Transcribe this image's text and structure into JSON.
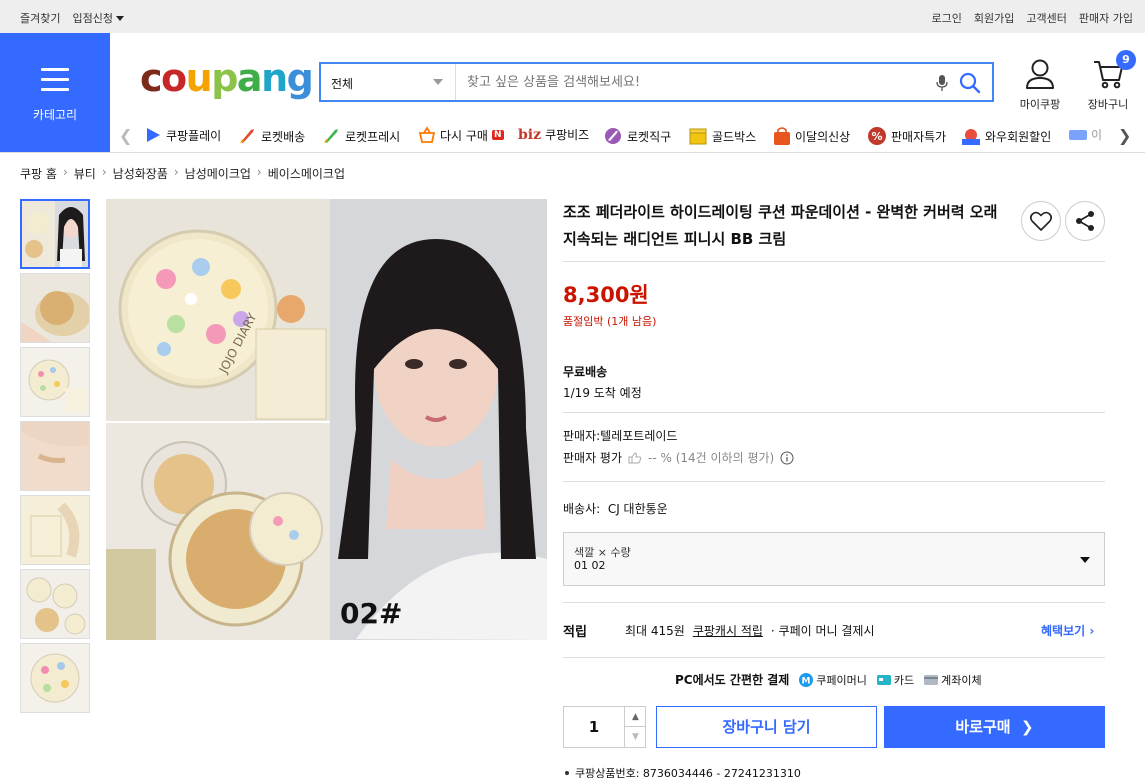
{
  "topbar": {
    "left": [
      "즐겨찾기",
      "입점신청"
    ],
    "right": [
      "로그인",
      "회원가입",
      "고객센터",
      "판매자 가입"
    ]
  },
  "header": {
    "category_label": "카테고리",
    "logo_letters": [
      "c",
      "o",
      "u",
      "p",
      "a",
      "n",
      "g"
    ],
    "search_scope": "전체",
    "search_placeholder": "찾고 싶은 상품을 검색해보세요!",
    "mypage_label": "마이쿠팡",
    "cart_label": "장바구니",
    "cart_count": "9"
  },
  "category_nav": [
    {
      "label": "쿠팡플레이",
      "icon": "play-icon",
      "color": "#346aff"
    },
    {
      "label": "로켓배송",
      "icon": "rocket-icon",
      "color": "#e04a2a"
    },
    {
      "label": "로켓프레시",
      "icon": "rocket-fresh-icon",
      "color": "#3bb54a"
    },
    {
      "label": "다시 구매",
      "icon": "basket-icon",
      "color": "#ff7a00",
      "badge": "N"
    },
    {
      "label": "쿠팡비즈",
      "icon": "biz-icon",
      "color": "#c0392b",
      "prefix": "biz"
    },
    {
      "label": "로켓직구",
      "icon": "global-icon",
      "color": "#8e44ad"
    },
    {
      "label": "골드박스",
      "icon": "goldbox-icon",
      "color": "#f1c40f"
    },
    {
      "label": "이달의신상",
      "icon": "shopping-bag-icon",
      "color": "#e67e22"
    },
    {
      "label": "판매자특가",
      "icon": "percent-icon",
      "color": "#c0392b"
    },
    {
      "label": "와우회원할인",
      "icon": "wow-icon",
      "color": "#e74c3c"
    },
    {
      "label": "이",
      "icon": "coupon-icon",
      "color": "#346aff"
    }
  ],
  "breadcrumb": [
    "쿠팡 홈",
    "뷰티",
    "남성화장품",
    "남성메이크업",
    "베이스메이크업"
  ],
  "product": {
    "title": "조조 페더라이트 하이드레이팅 쿠션 파운데이션 - 완벽한 커버력 오래 지속되는 래디언트 피니시 BB 크림",
    "price": "8,300원",
    "stock_note": "품절임박 (1개 남음)",
    "shipping_title": "무료배송",
    "arrival": "1/19 도착 예정",
    "seller_label": "판매자:",
    "seller_name": "텔레포트레이드",
    "seller_rating_label": "판매자 평가",
    "seller_rating_value": "-- % (14건 이하의 평가)",
    "carrier_label": "배송사:",
    "carrier": "CJ 대한통운",
    "option_label": "색깔 × 수량",
    "option_value": "01 02",
    "reward_label": "적립",
    "reward_max": "최대 415원",
    "reward_link": "쿠팡캐시 적립",
    "reward_cond": "· 쿠페이 머니 결제시",
    "benefit_link": "혜택보기",
    "pay_title": "PC에서도 간편한 결제",
    "pay_methods": [
      "쿠페이머니",
      "카드",
      "계좌이체"
    ],
    "quantity": "1",
    "cart_button": "장바구니 담기",
    "buy_button": "바로구매",
    "product_number": "쿠팡상품번호: 8736034446 - 27241231310",
    "image_label": "02#",
    "box_brand": "JOJO DIARY"
  },
  "colors": {
    "brand_blue": "#346aff",
    "price_red": "#cb1400"
  }
}
